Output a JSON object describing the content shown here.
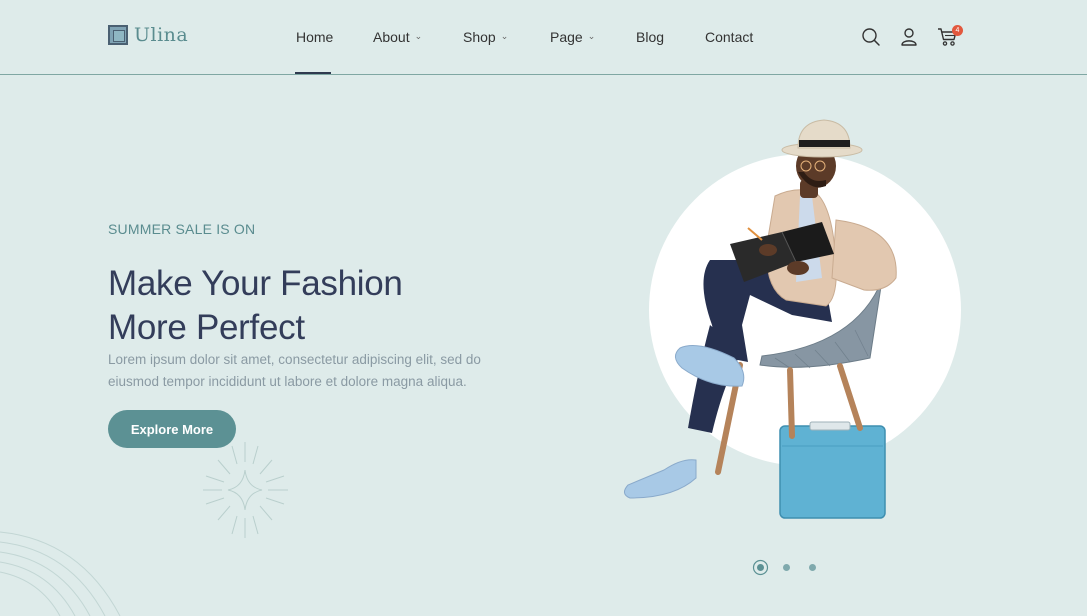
{
  "brand": {
    "name": "Ulina"
  },
  "nav": {
    "items": [
      {
        "label": "Home",
        "has_dropdown": false,
        "active": true
      },
      {
        "label": "About",
        "has_dropdown": true
      },
      {
        "label": "Shop",
        "has_dropdown": true
      },
      {
        "label": "Page",
        "has_dropdown": true
      },
      {
        "label": "Blog",
        "has_dropdown": false
      },
      {
        "label": "Contact",
        "has_dropdown": false
      }
    ],
    "chevron": "⌄"
  },
  "header_icons": {
    "search": "search-icon",
    "account": "user-icon",
    "cart": "cart-icon",
    "cart_count": "4"
  },
  "hero": {
    "eyebrow": "SUMMER SALE IS ON",
    "title_line1": "Make Your Fashion",
    "title_line2": "More Perfect",
    "description": "Lorem ipsum dolor sit amet, consectetur adipiscing elit, sed do eiusmod tempor incididunt ut labore et dolore magna aliqua.",
    "cta_label": "Explore More"
  },
  "slider": {
    "count": 3,
    "active_index": 0
  },
  "colors": {
    "background": "#deebea",
    "accent": "#5c9194",
    "heading": "#333d5a",
    "badge": "#e2583e"
  }
}
